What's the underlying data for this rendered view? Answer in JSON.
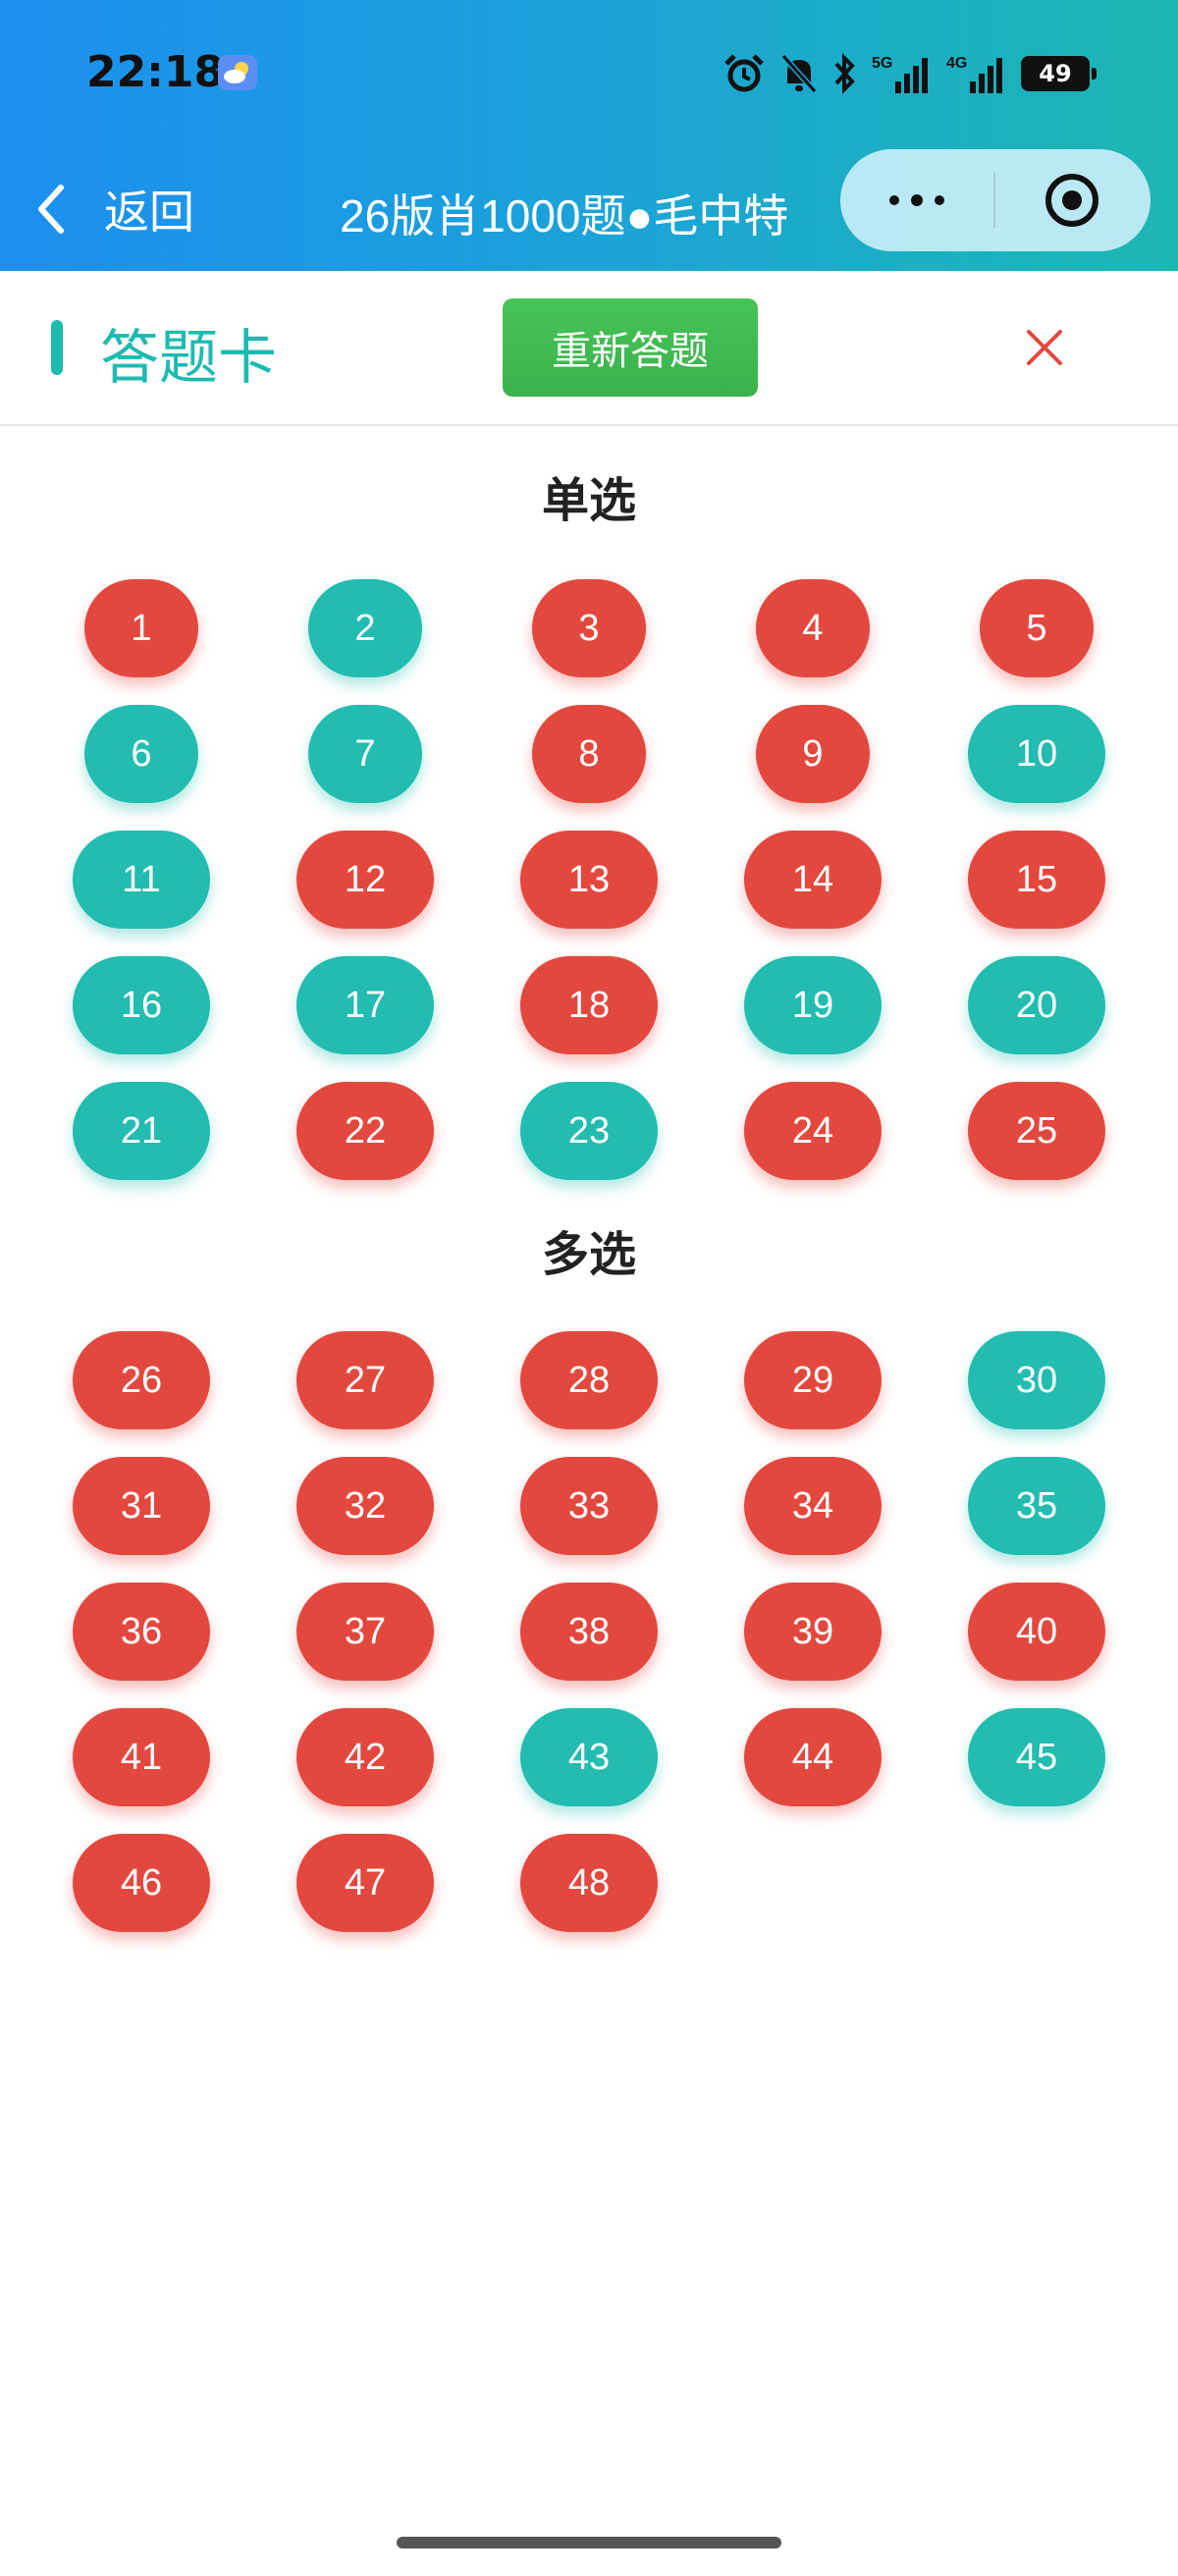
{
  "status_bar": {
    "time": "22:18",
    "net_5g": "5G",
    "net_4g": "4G",
    "battery": "49"
  },
  "nav": {
    "back_label": "返回",
    "title": "26版肖1000题●毛中特"
  },
  "card": {
    "title": "答题卡",
    "restart_label": "重新答题"
  },
  "colors": {
    "correct": "#22bcb0",
    "wrong": "#e3483f",
    "accent": "#1dbab0",
    "restart": "#3ab24c"
  },
  "sections": [
    {
      "title": "单选",
      "questions": [
        {
          "n": "1",
          "status": "wrong"
        },
        {
          "n": "2",
          "status": "correct"
        },
        {
          "n": "3",
          "status": "wrong"
        },
        {
          "n": "4",
          "status": "wrong"
        },
        {
          "n": "5",
          "status": "wrong"
        },
        {
          "n": "6",
          "status": "correct"
        },
        {
          "n": "7",
          "status": "correct"
        },
        {
          "n": "8",
          "status": "wrong"
        },
        {
          "n": "9",
          "status": "wrong"
        },
        {
          "n": "10",
          "status": "correct"
        },
        {
          "n": "11",
          "status": "correct"
        },
        {
          "n": "12",
          "status": "wrong"
        },
        {
          "n": "13",
          "status": "wrong"
        },
        {
          "n": "14",
          "status": "wrong"
        },
        {
          "n": "15",
          "status": "wrong"
        },
        {
          "n": "16",
          "status": "correct"
        },
        {
          "n": "17",
          "status": "correct"
        },
        {
          "n": "18",
          "status": "wrong"
        },
        {
          "n": "19",
          "status": "correct"
        },
        {
          "n": "20",
          "status": "correct"
        },
        {
          "n": "21",
          "status": "correct"
        },
        {
          "n": "22",
          "status": "wrong"
        },
        {
          "n": "23",
          "status": "correct"
        },
        {
          "n": "24",
          "status": "wrong"
        },
        {
          "n": "25",
          "status": "wrong"
        }
      ]
    },
    {
      "title": "多选",
      "questions": [
        {
          "n": "26",
          "status": "wrong"
        },
        {
          "n": "27",
          "status": "wrong"
        },
        {
          "n": "28",
          "status": "wrong"
        },
        {
          "n": "29",
          "status": "wrong"
        },
        {
          "n": "30",
          "status": "correct"
        },
        {
          "n": "31",
          "status": "wrong"
        },
        {
          "n": "32",
          "status": "wrong"
        },
        {
          "n": "33",
          "status": "wrong"
        },
        {
          "n": "34",
          "status": "wrong"
        },
        {
          "n": "35",
          "status": "correct"
        },
        {
          "n": "36",
          "status": "wrong"
        },
        {
          "n": "37",
          "status": "wrong"
        },
        {
          "n": "38",
          "status": "wrong"
        },
        {
          "n": "39",
          "status": "wrong"
        },
        {
          "n": "40",
          "status": "wrong"
        },
        {
          "n": "41",
          "status": "wrong"
        },
        {
          "n": "42",
          "status": "wrong"
        },
        {
          "n": "43",
          "status": "correct"
        },
        {
          "n": "44",
          "status": "wrong"
        },
        {
          "n": "45",
          "status": "correct"
        },
        {
          "n": "46",
          "status": "wrong"
        },
        {
          "n": "47",
          "status": "wrong"
        },
        {
          "n": "48",
          "status": "wrong"
        }
      ]
    }
  ]
}
